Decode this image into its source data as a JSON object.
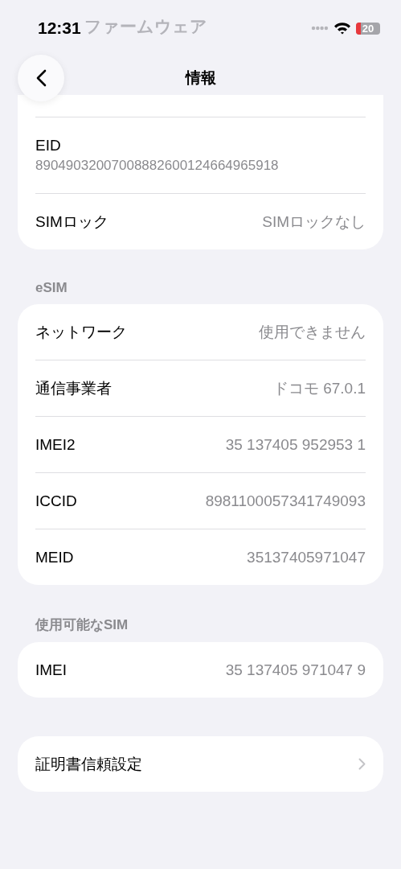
{
  "status_bar": {
    "time": "12:31",
    "faded_title": "ファームウェア",
    "battery": "20"
  },
  "nav": {
    "title": "情報"
  },
  "sections": [
    {
      "rows": [
        {
          "kind": "stacked",
          "label": "EID",
          "value": "89049032007008882600124664965918"
        },
        {
          "kind": "inline",
          "label": "SIMロック",
          "value": "SIMロックなし"
        }
      ]
    },
    {
      "header": "eSIM",
      "rows": [
        {
          "kind": "inline",
          "label": "ネットワーク",
          "value": "使用できません"
        },
        {
          "kind": "inline",
          "label": "通信事業者",
          "value": "ドコモ 67.0.1"
        },
        {
          "kind": "inline",
          "label": "IMEI2",
          "value": "35 137405 952953 1"
        },
        {
          "kind": "inline",
          "label": "ICCID",
          "value": "8981100057341749093"
        },
        {
          "kind": "inline",
          "label": "MEID",
          "value": "35137405971047"
        }
      ]
    },
    {
      "header": "使用可能なSIM",
      "rows": [
        {
          "kind": "inline",
          "label": "IMEI",
          "value": "35 137405 971047 9"
        }
      ]
    },
    {
      "rows": [
        {
          "kind": "link",
          "label": "証明書信頼設定"
        }
      ]
    }
  ]
}
